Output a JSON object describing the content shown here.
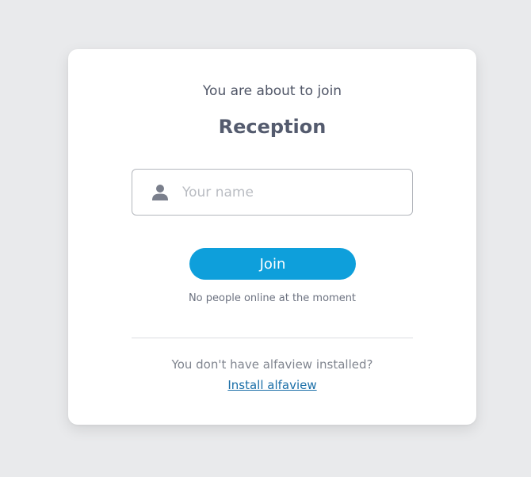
{
  "card": {
    "intro_text": "You are about to join",
    "room_name": "Reception"
  },
  "name_field": {
    "icon": "user-icon",
    "placeholder": "Your name",
    "value": ""
  },
  "join_button": {
    "label": "Join",
    "color": "#0e9fdb"
  },
  "status_text": "No people online at the moment",
  "install": {
    "question": "You don't have alfaview installed?",
    "link_label": "Install alfaview"
  }
}
